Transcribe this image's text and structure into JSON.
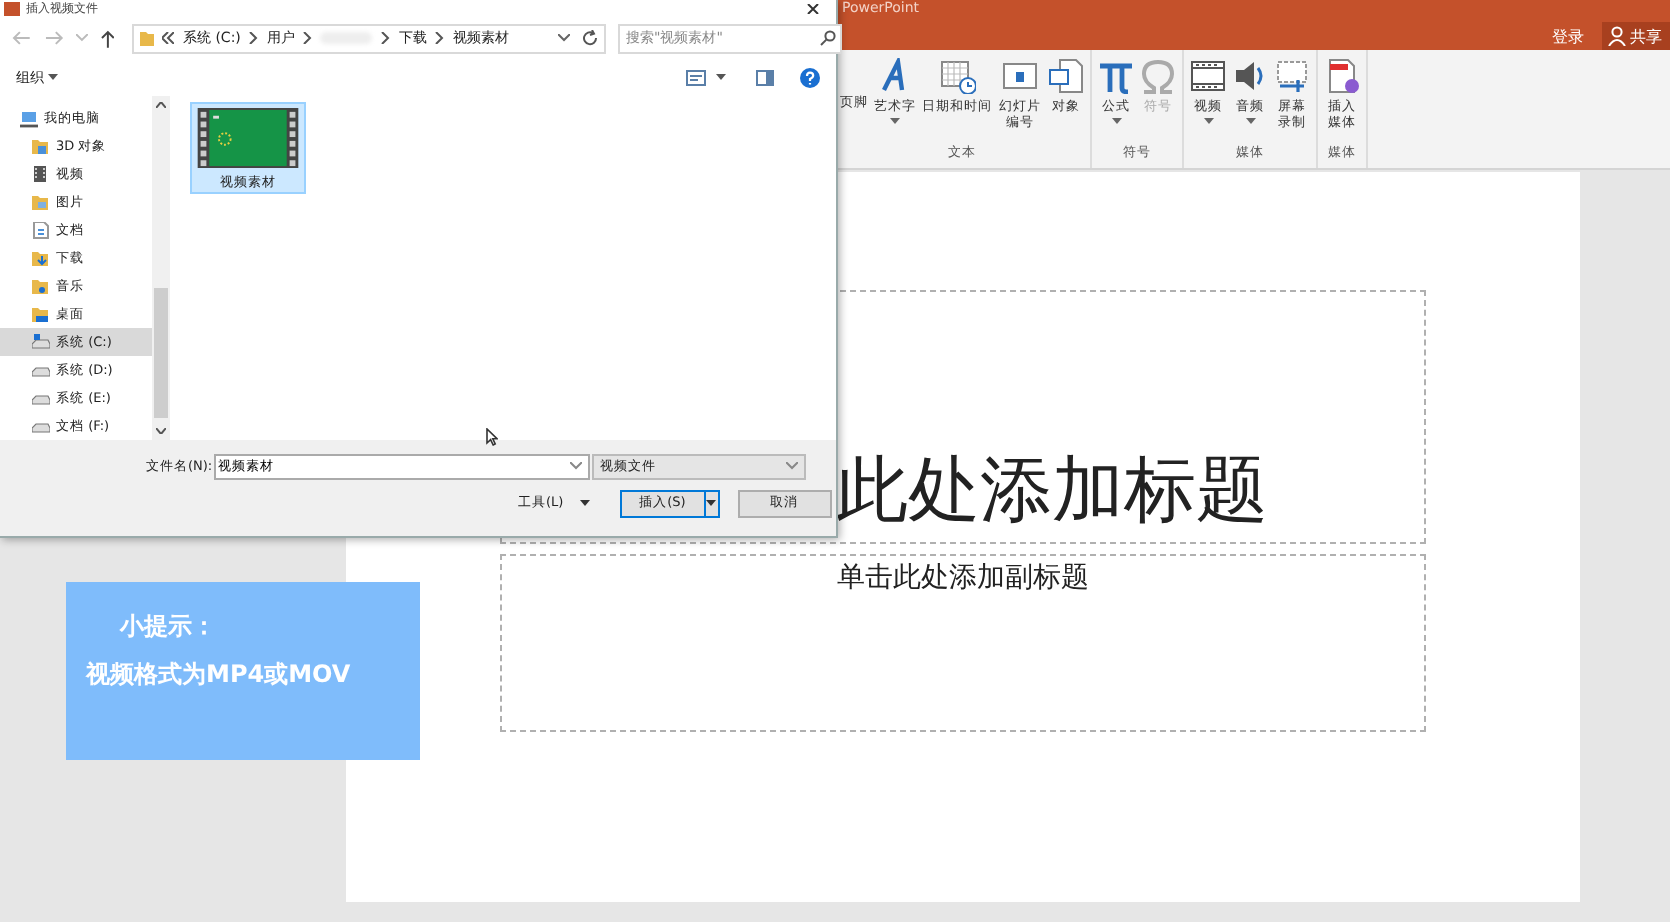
{
  "app": {
    "title": "PowerPoint",
    "account": [
      {
        "label": "登录"
      },
      {
        "label": "共享"
      }
    ]
  },
  "ribbon": {
    "groups": [
      {
        "label": "文本",
        "items": [
          {
            "label": "页脚",
            "dropdown": false,
            "disabled": false
          },
          {
            "label": "艺术字",
            "dropdown": true,
            "disabled": false
          },
          {
            "label": "日期和时间",
            "dropdown": false,
            "disabled": false
          },
          {
            "label": "幻灯片编号",
            "dropdown": false,
            "disabled": false
          },
          {
            "label": "对象",
            "dropdown": false,
            "disabled": false
          }
        ]
      },
      {
        "label": "符号",
        "items": [
          {
            "label": "公式",
            "dropdown": true,
            "disabled": false
          },
          {
            "label": "符号",
            "dropdown": false,
            "disabled": true
          }
        ]
      },
      {
        "label": "媒体",
        "items": [
          {
            "label": "视频",
            "dropdown": true,
            "disabled": false
          },
          {
            "label": "音频",
            "dropdown": true,
            "disabled": false
          },
          {
            "label": "屏幕录制",
            "dropdown": false,
            "disabled": false
          }
        ]
      },
      {
        "label": "媒体",
        "items": [
          {
            "label": "插入媒体",
            "dropdown": false,
            "disabled": false
          }
        ]
      }
    ]
  },
  "slide": {
    "title": "此处添加标题",
    "subtitle": "单击此处添加副标题"
  },
  "dialog": {
    "title": "插入视频文件",
    "breadcrumb": [
      "系统 (C:)",
      "用户",
      "下载",
      "视频素材"
    ],
    "search": {
      "placeholder": "搜索\"视频素材\""
    },
    "organize": "组织",
    "nav": [
      {
        "label": "我的电脑",
        "selected": false,
        "children": [
          {
            "label": "3D 对象",
            "selected": false
          },
          {
            "label": "视频",
            "selected": false
          },
          {
            "label": "图片",
            "selected": false
          },
          {
            "label": "文档",
            "selected": false
          },
          {
            "label": "下载",
            "selected": false
          },
          {
            "label": "音乐",
            "selected": false
          },
          {
            "label": "桌面",
            "selected": false
          },
          {
            "label": "系统 (C:)",
            "selected": true
          },
          {
            "label": "系统 (D:)",
            "selected": false
          },
          {
            "label": "系统 (E:)",
            "selected": false
          },
          {
            "label": "文档 (F:)",
            "selected": false
          }
        ]
      }
    ],
    "files": [
      {
        "label": "视频素材",
        "selected": true
      }
    ],
    "filename": {
      "label": "文件名(N):",
      "value": "视频素材"
    },
    "filetype": {
      "value": "视频文件"
    },
    "tools": "工具(L)",
    "buttons": [
      {
        "label": "插入(S)",
        "kind": "split",
        "default": true
      },
      {
        "label": "取消",
        "kind": "plain",
        "default": false
      }
    ]
  },
  "tip": {
    "title": "小提示：",
    "text": "视频格式为MP4或MOV"
  }
}
